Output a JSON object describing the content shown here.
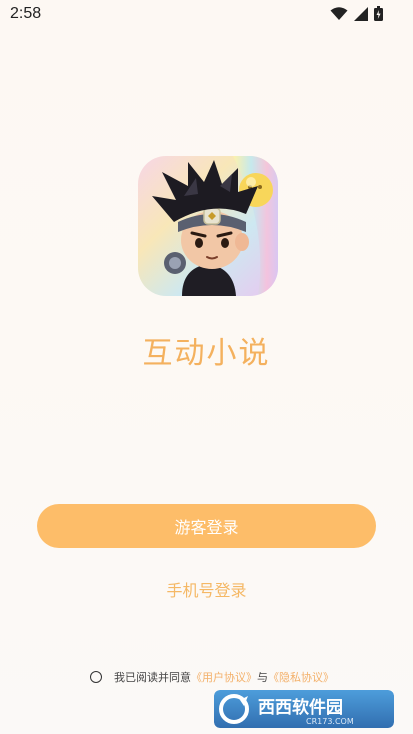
{
  "status_bar": {
    "time": "2:58",
    "icons": [
      "wifi-icon",
      "signal-icon",
      "battery-icon"
    ]
  },
  "app": {
    "title": "互动小说",
    "icon_name": "app-logo-character-icon"
  },
  "buttons": {
    "guest_login": "游客登录",
    "phone_login": "手机号登录"
  },
  "agreement": {
    "prefix": "我已阅读并同意",
    "user_agreement": "《用户协议》",
    "connector": "与",
    "privacy_policy": "《隐私协议》"
  },
  "watermark": {
    "main_text": "西西软件园",
    "sub_text": "CR173.COM"
  },
  "colors": {
    "accent": "#fdbd69",
    "title": "#f4b15e",
    "link": "#f3b069",
    "background": "#fdf8f3"
  }
}
